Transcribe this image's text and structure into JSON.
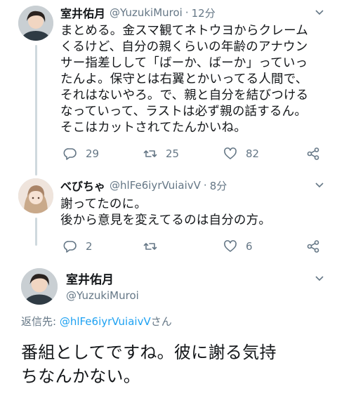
{
  "tweets": [
    {
      "name": "室井佑月",
      "handle": "@YuzukiMuroi",
      "dot": "·",
      "time": "12分",
      "lines": [
        "まとめる。金スマ観てネトウヨからクレーム",
        "くるけど、自分の親くらいの年齢のアナウン",
        "サー指差しして「ばーか、ばーか」っていっ",
        "たんよ。保守とは右翼とかいってる人間で、",
        "それはないやろ。で、親と自分を結びつける",
        "なっていって、ラストは必ず親の話するん。",
        "そこはカットされてたんかいね。"
      ],
      "reply_count": "29",
      "retweet_count": "25",
      "like_count": "82",
      "reply_icon": "reply-icon",
      "retweet_icon": "retweet-icon",
      "like_icon": "heart-icon",
      "share_icon": "share-icon"
    },
    {
      "name": "べびちゃ",
      "handle": "@hlFe6iyrVuiaivV",
      "dot": "·",
      "time": "8分",
      "lines": [
        "謝ってたのに。",
        "後から意見を変えてるのは自分の方。"
      ],
      "reply_count": "2",
      "retweet_count": "",
      "like_count": "6"
    }
  ],
  "main_tweet": {
    "name": "室井佑月",
    "handle": "@YuzukiMuroi",
    "reply_prefix": "返信先: ",
    "reply_handle": "@hlFe6iyrVuiaivV",
    "reply_suffix": "さん",
    "lines": [
      "番組としてですね。彼に謝る気持",
      "ちなんかない。"
    ]
  },
  "colors": {
    "text": "#14171a",
    "muted": "#657786",
    "link": "#1da1f2",
    "thread_line": "#cfd9de"
  }
}
